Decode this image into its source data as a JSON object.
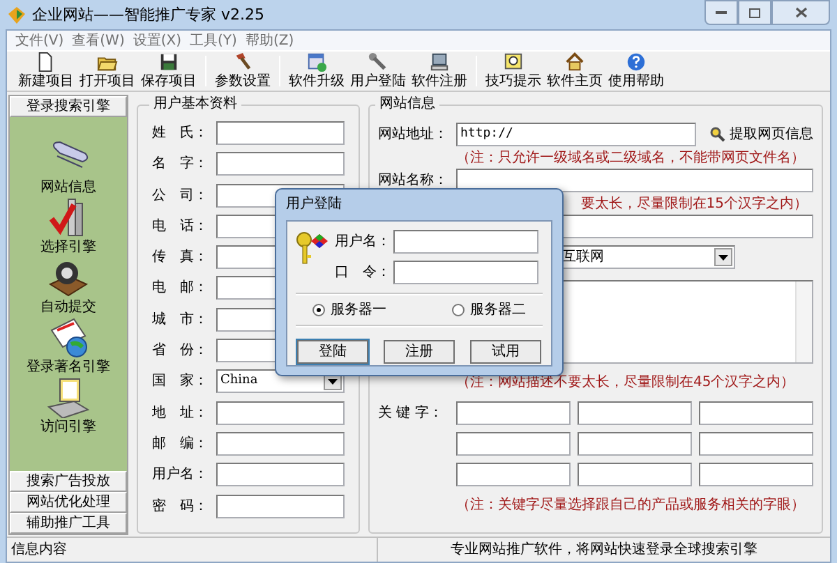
{
  "window": {
    "title": "企业网站——智能推广专家 v2.25"
  },
  "menu": [
    "文件(V)",
    "查看(W)",
    "设置(X)",
    "工具(Y)",
    "帮助(Z)"
  ],
  "toolbar": [
    {
      "buttons": [
        "新建项目",
        "打开项目",
        "保存项目"
      ]
    },
    {
      "buttons": [
        "参数设置"
      ]
    },
    {
      "buttons": [
        "软件升级",
        "用户登陆",
        "软件注册"
      ]
    },
    {
      "buttons": [
        "技巧提示",
        "软件主页",
        "使用帮助"
      ]
    }
  ],
  "sidebar": [
    {
      "label": "登录搜索引擎",
      "items": [
        "网站信息",
        "选择引擎",
        "自动提交",
        "登录著名引擎",
        "访问引擎"
      ]
    },
    {
      "label": "搜索广告投放"
    },
    {
      "label": "网站优化处理"
    },
    {
      "label": "辅助推广工具"
    }
  ],
  "basic_info": {
    "title": "用户基本资料",
    "fields": [
      {
        "label": "姓　氏：",
        "kind": "text"
      },
      {
        "label": "名　字：",
        "kind": "text"
      },
      {
        "label": "公　司：",
        "kind": "text"
      },
      {
        "label": "电　话：",
        "kind": "text"
      },
      {
        "label": "传　真：",
        "kind": "text"
      },
      {
        "label": "电　邮：",
        "kind": "text"
      },
      {
        "label": "城　市：",
        "kind": "text"
      },
      {
        "label": "省　份：",
        "kind": "text"
      },
      {
        "label": "国　家：",
        "kind": "select",
        "value": "China"
      },
      {
        "label": "地　址：",
        "kind": "text"
      },
      {
        "label": "邮　编：",
        "kind": "text"
      },
      {
        "label": "用户名：",
        "kind": "text"
      },
      {
        "label": "密　码：",
        "kind": "text"
      }
    ]
  },
  "site_info": {
    "title": "网站信息",
    "rows": [
      {
        "kind": "url",
        "label": "网站地址：",
        "value": "http://",
        "action": "提取网页信息"
      },
      {
        "kind": "note",
        "text": "（注：只允许一级域名或二级域名，不能带网页文件名）"
      },
      {
        "kind": "field",
        "label": "网站名称："
      },
      {
        "kind": "note_tail",
        "text": "要太长，尽量限制在15个汉字之内）"
      },
      {
        "kind": "field"
      },
      {
        "kind": "select",
        "value": "互联网"
      },
      {
        "kind": "textarea"
      },
      {
        "kind": "note",
        "text": "（注：网站描述不要太长，尽量限制在45个汉字之内）"
      },
      {
        "kind": "keywords",
        "label": "关 键 字："
      },
      {
        "kind": "note",
        "text": "（注：关键字尽量选择跟自己的产品或服务相关的字眼）"
      }
    ]
  },
  "dialog": {
    "title": "用户登陆",
    "fields": [
      {
        "label": "用户名："
      },
      {
        "label": "口　令："
      }
    ],
    "servers": [
      {
        "label": "服务器一",
        "selected": true
      },
      {
        "label": "服务器二",
        "selected": false
      }
    ],
    "buttons": [
      "登陆",
      "注册",
      "试用"
    ]
  },
  "status_bar": [
    "信息内容",
    "专业网站推广软件，将网站快速登录全球搜索引擎"
  ]
}
